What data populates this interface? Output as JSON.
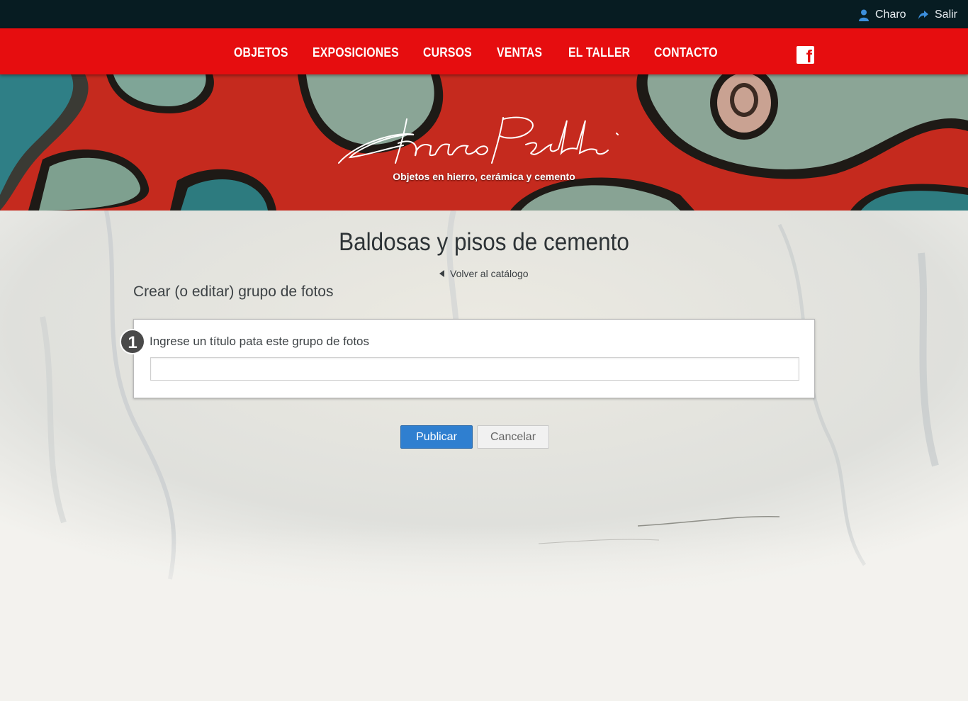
{
  "userbar": {
    "user_label": "Charo",
    "exit_label": "Salir",
    "icons": [
      "user-icon",
      "share-arrow-icon"
    ]
  },
  "nav": {
    "items": [
      {
        "label": "OBJETOS"
      },
      {
        "label": "EXPOSICIONES"
      },
      {
        "label": "CURSOS"
      },
      {
        "label": "VENTAS"
      },
      {
        "label": "EL TALLER"
      },
      {
        "label": "CONTACTO"
      }
    ],
    "facebook_icon": "facebook-icon"
  },
  "hero": {
    "signature": "Charo Perelli",
    "tagline": "Objetos en hierro, cerámica y cemento"
  },
  "main": {
    "title": "Baldosas y pisos de cemento",
    "back_label": "Volver al catálogo",
    "section_title": "Crear (o editar) grupo de fotos",
    "step_number": "1",
    "field_label": "Ingrese un título pata este grupo de fotos",
    "field_value": "",
    "publish_label": "Publicar",
    "cancel_label": "Cancelar"
  },
  "colors": {
    "topbar": "#071c22",
    "nav": "#e60d0f",
    "primary_button": "#2f7fd0",
    "page_bg": "#f3f2ee"
  }
}
